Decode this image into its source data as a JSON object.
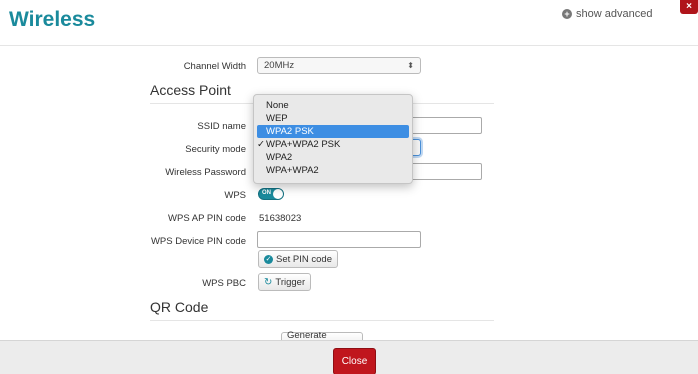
{
  "header": {
    "title": "Wireless",
    "show_advanced": "show advanced",
    "close_x": "×"
  },
  "form": {
    "channel_width": {
      "label": "Channel Width",
      "value": "20MHz"
    },
    "access_point": {
      "title": "Access Point"
    },
    "ssid": {
      "label": "SSID name",
      "value": ""
    },
    "security_mode": {
      "label": "Security mode"
    },
    "wireless_password": {
      "label": "Wireless Password",
      "value": ""
    },
    "wps": {
      "label": "WPS",
      "toggle": "ON",
      "enabled": true
    },
    "wps_ap_pin": {
      "label": "WPS AP PIN code",
      "value": "51638023"
    },
    "wps_device_pin": {
      "label": "WPS Device PIN code",
      "value": "",
      "button": "Set PIN code"
    },
    "wps_pbc": {
      "label": "WPS PBC",
      "button": "Trigger"
    },
    "qr_code": {
      "title": "QR Code",
      "button": "Generate QRCode"
    }
  },
  "security_dropdown": {
    "options": [
      "None",
      "WEP",
      "WPA2 PSK",
      "WPA+WPA2 PSK",
      "WPA2",
      "WPA+WPA2"
    ],
    "highlighted": "WPA2 PSK",
    "selected": "WPA+WPA2 PSK",
    "check_mark": "✓"
  },
  "footer": {
    "close_label": "Close"
  },
  "colors": {
    "accent": "#1a8a9c",
    "danger": "#c0161d",
    "highlight": "#3d8ee3"
  },
  "icons": {
    "show_advanced": "plus-circle-icon",
    "set_pin": "ok-circle-icon",
    "trigger": "refresh-icon",
    "select_arrows": "updown-chevron-icon"
  }
}
